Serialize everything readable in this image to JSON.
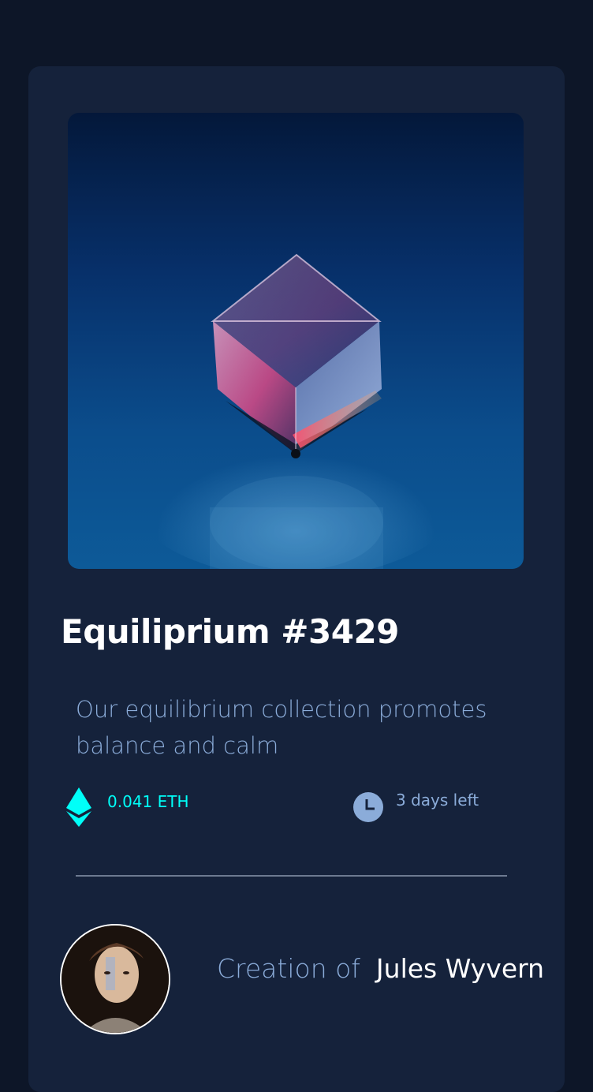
{
  "nft": {
    "title": "Equiliprium #3429",
    "description": "Our equilibrium collection promotes balance and calm",
    "price": "0.041 ETH",
    "time_left": "3 days left"
  },
  "icons": {
    "price": "ethereum-icon",
    "time": "clock-icon"
  },
  "creator": {
    "label": "Creation of",
    "name": "Jules Wyvern"
  },
  "colors": {
    "page_bg": "#0d1628",
    "card_bg": "#15223b",
    "accent_cyan": "#00fff8",
    "soft_blue": "#8bacd9",
    "white": "#ffffff"
  }
}
